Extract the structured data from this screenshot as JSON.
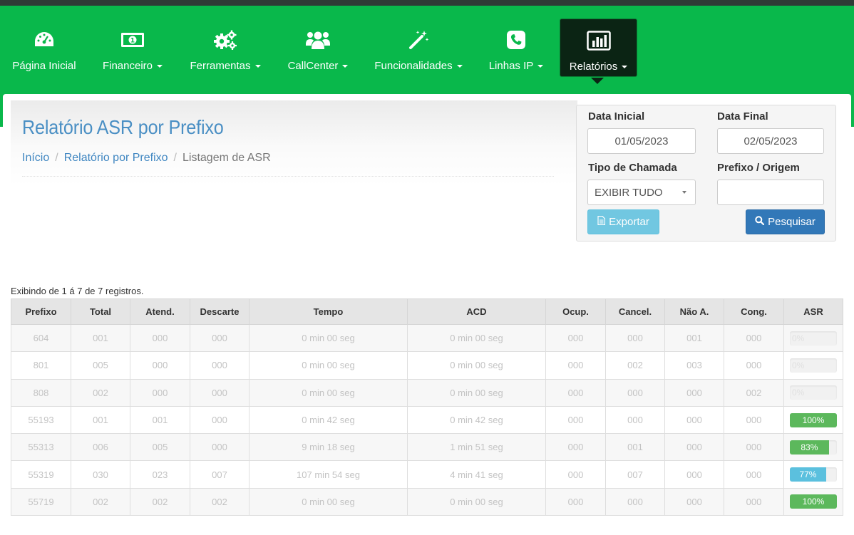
{
  "nav": {
    "items": [
      {
        "key": "home",
        "label": "Página Inicial",
        "icon": "speedometer-icon",
        "dropdown": false
      },
      {
        "key": "financeiro",
        "label": "Financeiro",
        "icon": "money-bill-icon",
        "dropdown": true
      },
      {
        "key": "ferramentas",
        "label": "Ferramentas",
        "icon": "gears-icon",
        "dropdown": true
      },
      {
        "key": "callcenter",
        "label": "CallCenter",
        "icon": "users-icon",
        "dropdown": true
      },
      {
        "key": "funcionalidades",
        "label": "Funcionalidades",
        "icon": "magic-wand-icon",
        "dropdown": true
      },
      {
        "key": "linhasip",
        "label": "Linhas IP",
        "icon": "phone-icon",
        "dropdown": true
      },
      {
        "key": "relatorios",
        "label": "Relatórios",
        "icon": "bar-chart-icon",
        "dropdown": true,
        "active": true
      }
    ]
  },
  "page": {
    "title": "Relatório ASR por Prefixo",
    "breadcrumb": [
      "Início",
      "Relatório por Prefixo",
      "Listagem de ASR"
    ]
  },
  "filters": {
    "data_inicial_label": "Data Inicial",
    "data_inicial_value": "01/05/2023",
    "data_final_label": "Data Final",
    "data_final_value": "02/05/2023",
    "tipo_chamada_label": "Tipo de Chamada",
    "tipo_chamada_value": "EXIBIR TUDO",
    "prefixo_label": "Prefixo / Origem",
    "prefixo_value": "",
    "export_label": "Exportar",
    "search_label": "Pesquisar"
  },
  "table": {
    "info": "Exibindo de 1 á 7 de 7 registros.",
    "columns": [
      "Prefixo",
      "Total",
      "Atend.",
      "Descarte",
      "Tempo",
      "ACD",
      "Ocup.",
      "Cancel.",
      "Não A.",
      "Cong.",
      "ASR"
    ],
    "rows": [
      {
        "prefixo": "604",
        "total": "001",
        "atend": "000",
        "descarte": "000",
        "tempo": "0 min 00 seg",
        "acd": "0 min 00 seg",
        "ocup": "000",
        "cancel": "000",
        "naoa": "001",
        "cong": "000",
        "asr_label": "0%",
        "asr": 0
      },
      {
        "prefixo": "801",
        "total": "005",
        "atend": "000",
        "descarte": "000",
        "tempo": "0 min 00 seg",
        "acd": "0 min 00 seg",
        "ocup": "000",
        "cancel": "002",
        "naoa": "003",
        "cong": "000",
        "asr_label": "0%",
        "asr": 0
      },
      {
        "prefixo": "808",
        "total": "002",
        "atend": "000",
        "descarte": "000",
        "tempo": "0 min 00 seg",
        "acd": "0 min 00 seg",
        "ocup": "000",
        "cancel": "000",
        "naoa": "000",
        "cong": "002",
        "asr_label": "0%",
        "asr": 0
      },
      {
        "prefixo": "55193",
        "total": "001",
        "atend": "001",
        "descarte": "000",
        "tempo": "0 min 42 seg",
        "acd": "0 min 42 seg",
        "ocup": "000",
        "cancel": "000",
        "naoa": "000",
        "cong": "000",
        "asr_label": "100%",
        "asr": 100
      },
      {
        "prefixo": "55313",
        "total": "006",
        "atend": "005",
        "descarte": "000",
        "tempo": "9 min 18 seg",
        "acd": "1 min 51 seg",
        "ocup": "000",
        "cancel": "001",
        "naoa": "000",
        "cong": "000",
        "asr_label": "83%",
        "asr": 83
      },
      {
        "prefixo": "55319",
        "total": "030",
        "atend": "023",
        "descarte": "007",
        "tempo": "107 min 54 seg",
        "acd": "4 min 41 seg",
        "ocup": "000",
        "cancel": "007",
        "naoa": "000",
        "cong": "000",
        "asr_label": "77%",
        "asr": 77
      },
      {
        "prefixo": "55719",
        "total": "002",
        "atend": "002",
        "descarte": "002",
        "tempo": "0 min 00 seg",
        "acd": "0 min 00 seg",
        "ocup": "000",
        "cancel": "000",
        "naoa": "000",
        "cong": "000",
        "asr_label": "100%",
        "asr": 100
      }
    ]
  },
  "colors": {
    "nav_green": "#09b84b",
    "asr_success": "#5cb85c",
    "asr_info": "#5bc0de",
    "link_blue": "#3f86c1"
  }
}
